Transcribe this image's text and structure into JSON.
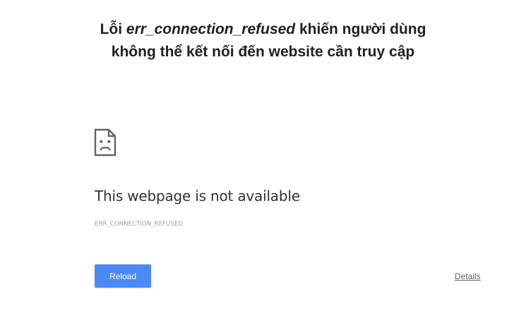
{
  "caption": {
    "line1_prefix": "Lỗi ",
    "line1_code": "err_connection_refused",
    "line1_suffix": " khiến người dùng",
    "line2": "không thể kết nối đến website cần truy cập"
  },
  "error_page": {
    "icon": "sad-page-icon",
    "title": "This webpage is not available",
    "error_code": "ERR_CONNECTION_REFUSED",
    "reload_label": "Reload",
    "details_label": "Details"
  },
  "colors": {
    "reload_button": "#4a8af4",
    "text": "#333333",
    "error_code": "#9e9e9e"
  }
}
